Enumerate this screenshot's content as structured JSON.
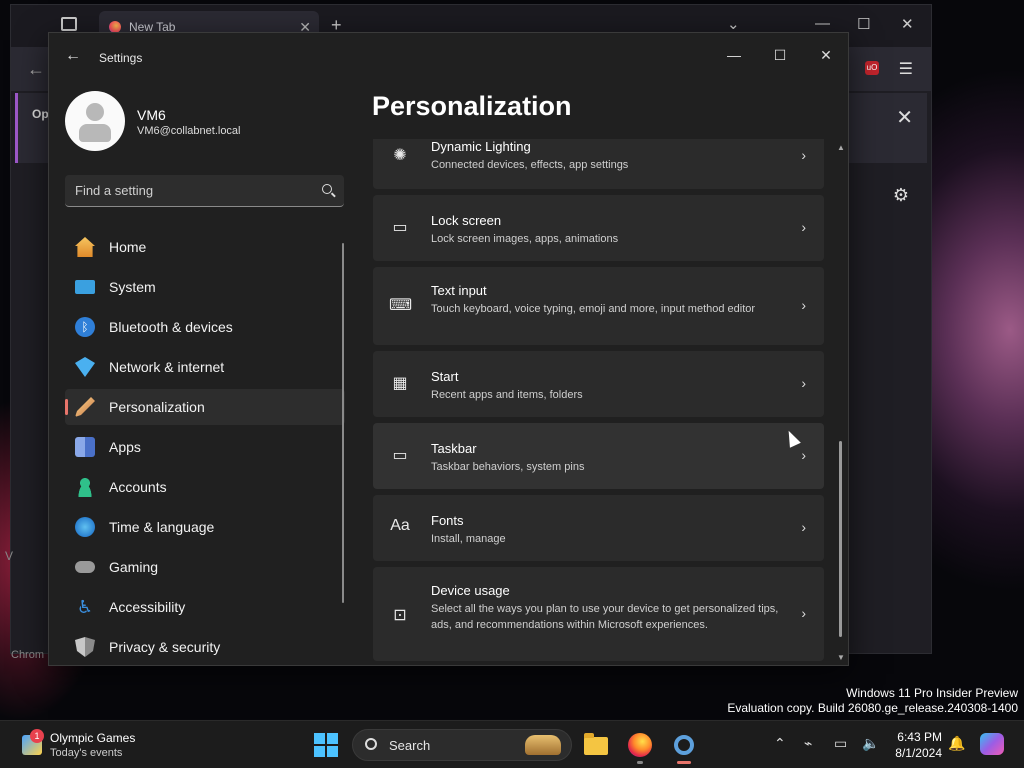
{
  "browser": {
    "tab_title": "New Tab",
    "notification_prefix": "Op",
    "side_letter": "V",
    "bottom_label": "Chrom"
  },
  "settings": {
    "window_title": "Settings",
    "user": {
      "name": "VM6",
      "email": "VM6@collabnet.local"
    },
    "search_placeholder": "Find a setting",
    "nav": [
      {
        "label": "Home",
        "icon": "home-icon",
        "color": "#f0a030"
      },
      {
        "label": "System",
        "icon": "system-icon",
        "color": "#3aa0e0"
      },
      {
        "label": "Bluetooth & devices",
        "icon": "bluetooth-icon",
        "color": "#2f7fd8"
      },
      {
        "label": "Network & internet",
        "icon": "wifi-icon",
        "color": "#4ab0f0"
      },
      {
        "label": "Personalization",
        "icon": "brush-icon",
        "color": "#e8b070",
        "active": true
      },
      {
        "label": "Apps",
        "icon": "apps-icon",
        "color": "#6a8fd8"
      },
      {
        "label": "Accounts",
        "icon": "accounts-icon",
        "color": "#2fc08a"
      },
      {
        "label": "Time & language",
        "icon": "globe-clock-icon",
        "color": "#3a9ae0"
      },
      {
        "label": "Gaming",
        "icon": "gamepad-icon",
        "color": "#9a9a9a"
      },
      {
        "label": "Accessibility",
        "icon": "accessibility-icon",
        "color": "#3a8fe0"
      },
      {
        "label": "Privacy & security",
        "icon": "shield-icon",
        "color": "#8a8a8a"
      }
    ],
    "page_title": "Personalization",
    "cards": [
      {
        "title": "Dynamic Lighting",
        "subtitle": "Connected devices, effects, app settings",
        "icon": "lighting-icon"
      },
      {
        "title": "Lock screen",
        "subtitle": "Lock screen images, apps, animations",
        "icon": "lock-screen-icon"
      },
      {
        "title": "Text input",
        "subtitle": "Touch keyboard, voice typing, emoji and more, input method editor",
        "icon": "keyboard-icon"
      },
      {
        "title": "Start",
        "subtitle": "Recent apps and items, folders",
        "icon": "start-menu-icon"
      },
      {
        "title": "Taskbar",
        "subtitle": "Taskbar behaviors, system pins",
        "icon": "taskbar-icon"
      },
      {
        "title": "Fonts",
        "subtitle": "Install, manage",
        "icon": "fonts-icon"
      },
      {
        "title": "Device usage",
        "subtitle": "Select all the ways you plan to use your device to get personalized tips, ads, and recommendations within Microsoft experiences.",
        "icon": "device-usage-icon"
      }
    ]
  },
  "watermark": {
    "line1": "Windows 11 Pro Insider Preview",
    "line2": "Evaluation copy. Build 26080.ge_release.240308-1400"
  },
  "taskbar": {
    "widget_badge": "1",
    "widget_title": "Olympic Games",
    "widget_subtitle": "Today's events",
    "search_label": "Search",
    "time": "6:43 PM",
    "date": "8/1/2024"
  }
}
